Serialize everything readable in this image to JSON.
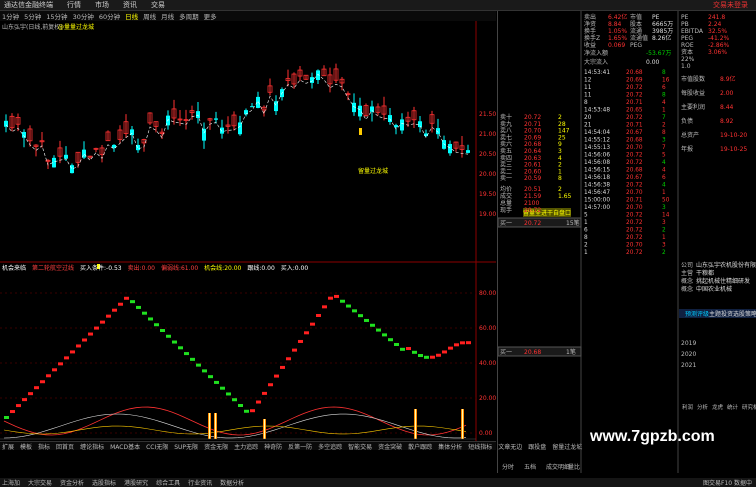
{
  "menu": {
    "items": [
      "通达信金融终端",
      "行情",
      "市场",
      "资讯",
      "交易"
    ],
    "title": "交易未登录"
  },
  "periods": [
    "1分钟",
    "5分钟",
    "15分钟",
    "30分钟",
    "60分钟",
    "日线",
    "周线",
    "月线",
    "多周期",
    "更多"
  ],
  "active_period": "日线",
  "chart_info": "山东弘宇(日线,前复权)",
  "chart_info2": "@量量过龙城",
  "sub_info": [
    {
      "text": "机会来临",
      "color": "#ffffff"
    },
    {
      "text": "第二轮航空过线",
      "color": "#ff4040"
    },
    {
      "text": "买入条件:-0.53",
      "color": "#ffffff"
    },
    {
      "text": "卖出:0.00",
      "color": "#ff4040"
    },
    {
      "text": "偏弱线:61.00",
      "color": "#ff4040"
    },
    {
      "text": "机会线:20.00",
      "color": "#ffff00"
    },
    {
      "text": "跟线:0.00",
      "color": "#ffffff"
    },
    {
      "text": "买入:0.00",
      "color": "#ffffff"
    }
  ],
  "annotation": "留量过龙城",
  "annotation2": "留量全进干自盘口",
  "price_axis": [
    "21.50",
    "21.00",
    "20.50",
    "20.00",
    "19.50",
    "19.00"
  ],
  "ind_axis": [
    "80.00",
    "60.00",
    "40.00",
    "20.00",
    "0.00"
  ],
  "bottom_tabs": [
    "扩展",
    "模板",
    "指标",
    "回首页",
    "缠论指标",
    "MACD基本",
    "CCI无限",
    "SUP无限",
    "资金无限",
    "主力追踪",
    "神奇防",
    "反第一防",
    "多空追踪",
    "智能交易",
    "资金突破",
    "散户跟踪",
    "集体分析",
    "短线指标",
    "文章无边",
    "跟投盘",
    "留量过龙城"
  ],
  "status": [
    "上海加",
    "大宗交易",
    "资金分析",
    "选股指标",
    "港股研究",
    "综合工具",
    "行业资讯",
    "数据分析"
  ],
  "status_right": "图交易F10 数据中",
  "watermark": "www.7gpzb.com",
  "order_book": {
    "asks": [
      [
        "卖十",
        "20.72",
        "2"
      ],
      [
        "卖九",
        "20.71",
        "28"
      ],
      [
        "卖八",
        "20.70",
        "147"
      ],
      [
        "卖七",
        "20.69",
        "25"
      ],
      [
        "卖六",
        "20.68",
        "9"
      ],
      [
        "卖五",
        "20.64",
        "3"
      ],
      [
        "卖四",
        "20.63",
        "4"
      ],
      [
        "卖三",
        "20.61",
        "2"
      ],
      [
        "卖二",
        "20.60",
        "1"
      ],
      [
        "卖一",
        "20.59",
        "8"
      ]
    ],
    "mid": [
      [
        "均价",
        "20.51",
        "2"
      ],
      [
        "成交",
        "21.59",
        "1.65"
      ],
      [
        "总量",
        "2100",
        ""
      ],
      [
        "现手",
        "20.72",
        "",
        ""
      ]
    ],
    "bid_box": [
      "买一",
      "20.72",
      "15笔"
    ],
    "ind_box": [
      "买一",
      "20.68",
      "1笔"
    ]
  },
  "quote": [
    [
      "卖出",
      "6.42亿",
      "市值",
      "PE",
      "241.8"
    ],
    [
      "净资",
      "8.84",
      "股本",
      "6665万",
      "PB"
    ],
    [
      "换手",
      "1.05%",
      "流通",
      "3985万"
    ],
    [
      "换手Z",
      "1.65%",
      "流通值",
      "8.26亿"
    ],
    [
      "收益",
      "0.069",
      "PEG"
    ]
  ],
  "flow": [
    [
      "净流入额",
      "-53.67万"
    ],
    [
      "大宗流入",
      "0.00"
    ]
  ],
  "ticks": [
    [
      "14:53:41",
      "20.68",
      "8"
    ],
    [
      "12",
      "20.69",
      "16"
    ],
    [
      "11",
      "20.72",
      "6"
    ],
    [
      "11",
      "20.72",
      "8"
    ],
    [
      "8",
      "20.71",
      "4"
    ],
    [
      "14:53:48",
      "20.65",
      "1"
    ],
    [
      "20",
      "20.72",
      "7"
    ],
    [
      "21",
      "20.71",
      "2"
    ],
    [
      "14:54:04",
      "20.67",
      "8"
    ],
    [
      "14:55:12",
      "20.68",
      "3"
    ],
    [
      "14:55:13",
      "20.70",
      "7"
    ],
    [
      "14:56:06",
      "20.72",
      "5"
    ],
    [
      "14:56:08",
      "20.72",
      "4"
    ],
    [
      "14:56:15",
      "20.68",
      "4"
    ],
    [
      "14:56:18",
      "20.67",
      "6"
    ],
    [
      "14:56:38",
      "20.72",
      "4"
    ],
    [
      "14:56:47",
      "20.70",
      "1"
    ],
    [
      "15:00:00",
      "20.71",
      "50"
    ],
    [
      "14:57:00",
      "20.70",
      "3"
    ],
    [
      "5",
      "20.72",
      "14"
    ],
    [
      "1",
      "20.72",
      "3"
    ],
    [
      "6",
      "20.72",
      "2"
    ],
    [
      "8",
      "20.72",
      "1"
    ],
    [
      "2",
      "20.70",
      "3"
    ],
    [
      "1",
      "20.72",
      "2"
    ]
  ],
  "fund": [
    [
      "PE",
      "241.8"
    ],
    [
      "PB",
      "2.24"
    ],
    [
      "EBITDA",
      "32.5%"
    ],
    [
      "PEG",
      "-41.2%"
    ],
    [
      "ROE",
      "-2.86%"
    ],
    [
      "资本",
      "3.06%"
    ],
    [
      "22%",
      ""
    ],
    [
      "1.0",
      ""
    ]
  ],
  "fund2": [
    [
      "市值股数",
      "8.9亿"
    ],
    [
      "每股收益",
      "2.00"
    ],
    [
      "主要利润",
      "8.44"
    ],
    [
      "负债",
      "8.92"
    ],
    [
      "总资产",
      "19-10-20"
    ],
    [
      "年报",
      "19-10-25"
    ]
  ],
  "company": [
    "公司",
    "山东弘宇农机股份有限公司",
    "主营",
    "干粮都",
    "概念",
    "挑起机械住精细研发",
    "概念",
    "中国农业机械"
  ],
  "years": [
    "2019",
    "2020",
    "2021"
  ],
  "tabs": [
    "预测评级",
    "主题投资",
    "选股策略"
  ],
  "rtabs": [
    "利润",
    "分析",
    "龙虎",
    "统计",
    "研究机构"
  ],
  "ticker_bar": [
    "分时",
    "五档",
    "成交明细",
    "量比"
  ]
}
